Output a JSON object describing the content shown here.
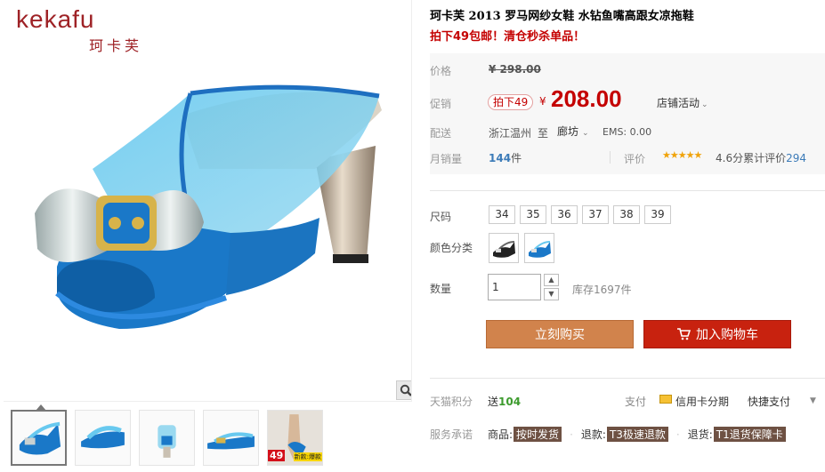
{
  "brand": {
    "logo_en": "kekafu",
    "logo_cn": "珂卡芙"
  },
  "product": {
    "title": "珂卡芙 2013 罗马网纱女鞋 水钻鱼嘴高跟女凉拖鞋",
    "subtitle": "拍下49包邮！清仓秒杀单品！"
  },
  "price": {
    "label": "价格",
    "original": "¥ 298.00",
    "promo_label": "促销",
    "promo_tag": "拍下49",
    "currency": "¥",
    "promo_price": "208.00",
    "shop_activity": "店铺活动"
  },
  "shipping": {
    "label": "配送",
    "from": "浙江温州",
    "to_word": "至",
    "to_city": "廊坊",
    "ems": "EMS: 0.00"
  },
  "sales": {
    "label": "月销量",
    "count": "144",
    "unit": "件",
    "rating_label": "评价",
    "score_text": "4.6分累计评价",
    "review_count": "294",
    "rating_value": 4.6
  },
  "options": {
    "size_label": "尺码",
    "sizes": [
      "34",
      "35",
      "36",
      "37",
      "38",
      "39"
    ],
    "color_label": "颜色分类",
    "colors": [
      "black-slipper",
      "blue-slipper"
    ],
    "qty_label": "数量",
    "qty_value": "1",
    "stock": "库存1697件"
  },
  "actions": {
    "buy_now": "立刻购买",
    "add_cart": "加入购物车"
  },
  "points": {
    "label": "天猫积分",
    "prefix": "送",
    "value": "104"
  },
  "payment": {
    "label": "支付",
    "credit": "信用卡分期",
    "quick": "快捷支付"
  },
  "service": {
    "label": "服务承诺",
    "items": [
      {
        "prefix": "商品:",
        "tag": "按时发货"
      },
      {
        "prefix": "退款:",
        "tag": "T3极速退款"
      },
      {
        "prefix": "退货:",
        "tag": "T1退货保障卡"
      }
    ]
  },
  "thumbs": {
    "badge": "49",
    "hot": "新款:爆款"
  },
  "colors": {
    "red": "#c40000",
    "buy": "#d1834c",
    "cart": "#c8220f",
    "brand": "#9e2226",
    "link": "#3c7bb8",
    "green": "#3d9b2e"
  },
  "icons": [
    "zoom-icon",
    "cart-icon",
    "chevron-down-icon",
    "card-icon",
    "star-icon"
  ]
}
